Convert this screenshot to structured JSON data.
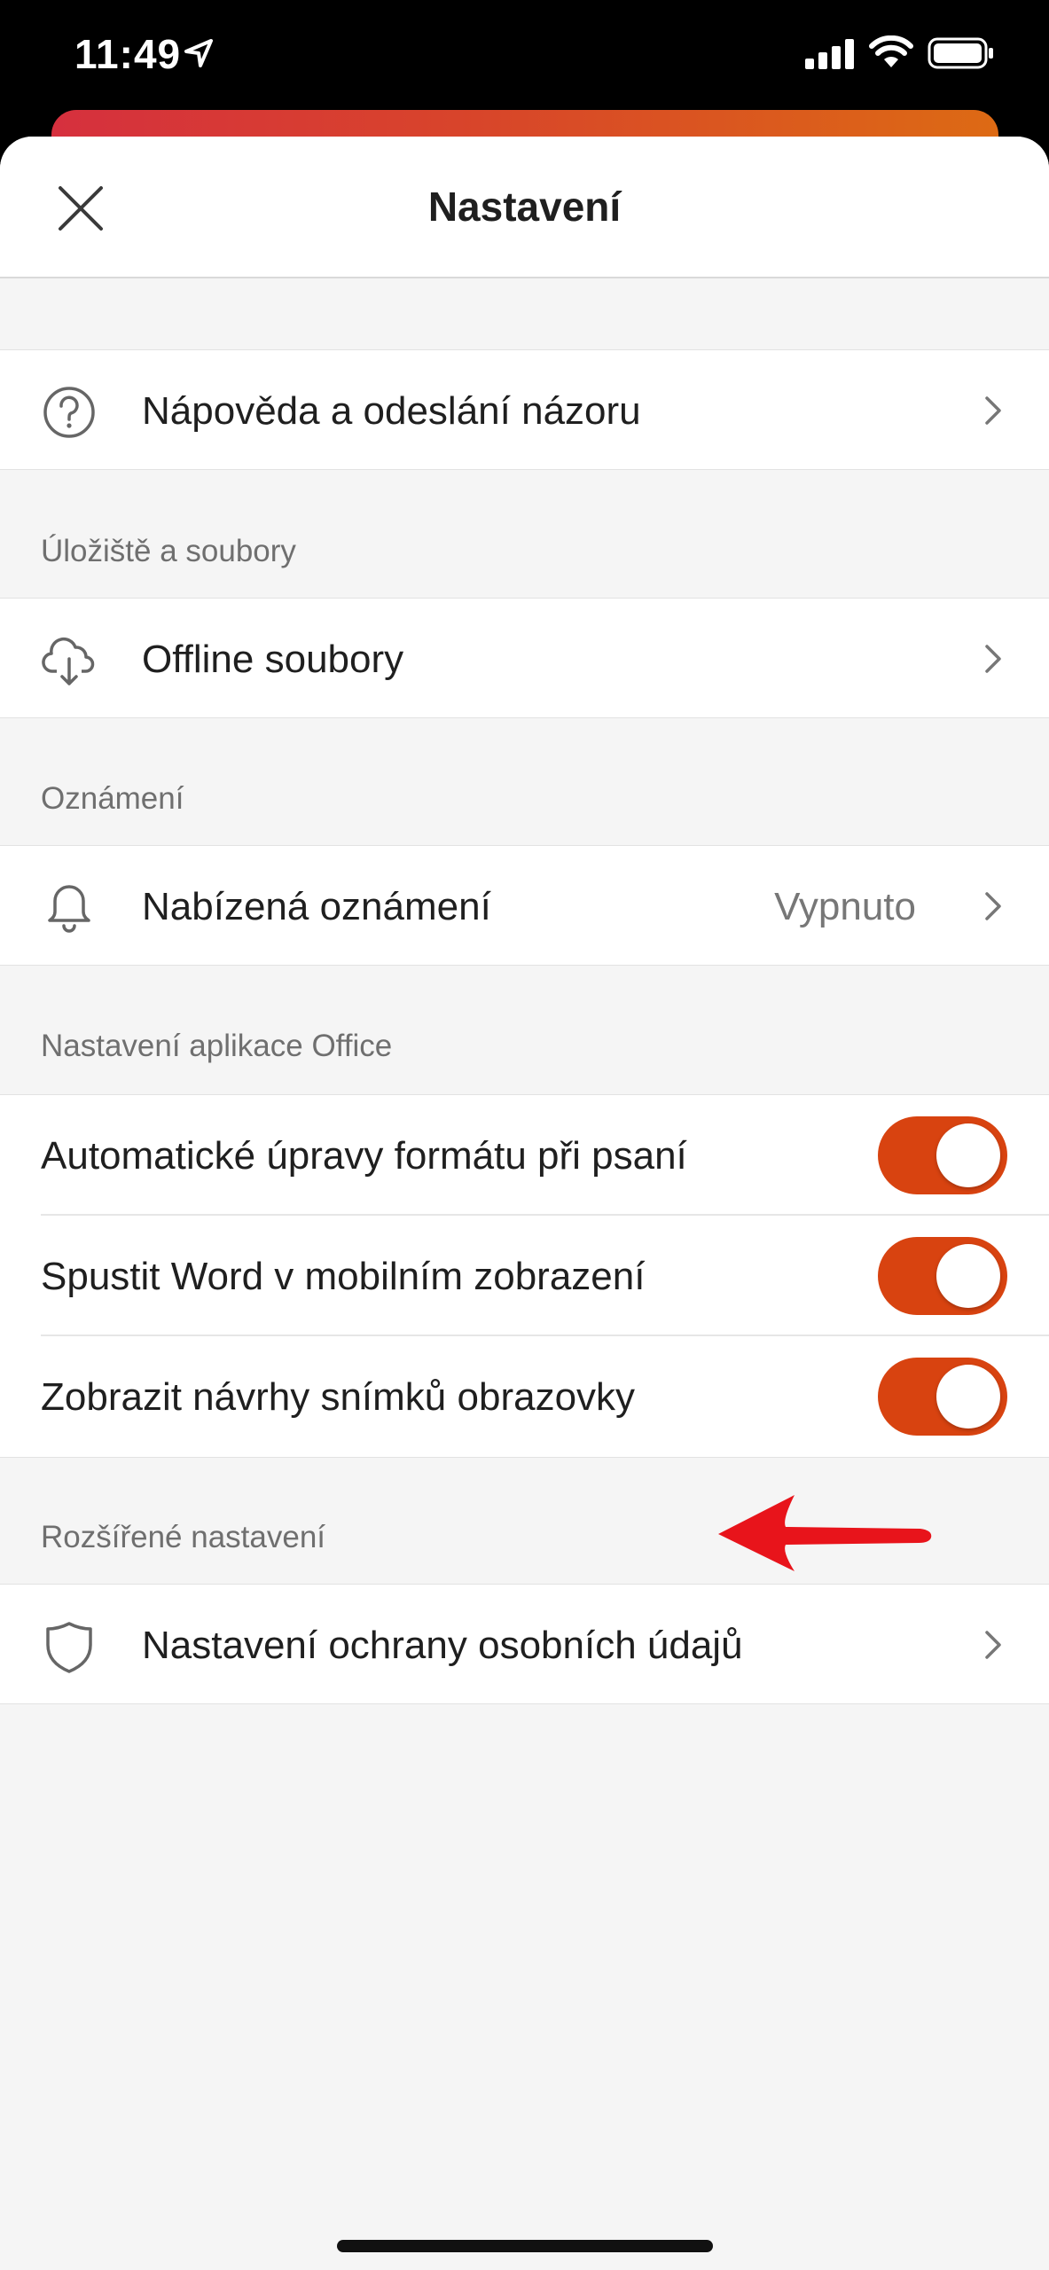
{
  "status_bar": {
    "time": "11:49"
  },
  "header": {
    "title": "Nastavení"
  },
  "help_row": {
    "label": "Nápověda a odeslání názoru"
  },
  "storage": {
    "section_label": "Úložiště a soubory",
    "offline_label": "Offline soubory"
  },
  "notifications": {
    "section_label": "Oznámení",
    "push_label": "Nabízená oznámení",
    "push_value": "Vypnuto"
  },
  "office_settings": {
    "section_label": "Nastavení aplikace Office",
    "toggles": [
      {
        "label": "Automatické úpravy formátu při psaní",
        "on": true
      },
      {
        "label": "Spustit Word v mobilním zobrazení",
        "on": true
      },
      {
        "label": "Zobrazit návrhy snímků obrazovky",
        "on": true
      }
    ]
  },
  "advanced": {
    "section_label": "Rozšířené nastavení",
    "privacy_label": "Nastavení ochrany osobních údajů"
  },
  "colors": {
    "accent": "#d84310",
    "annotation_arrow": "#e8141b"
  },
  "icons": [
    "location-arrow-icon",
    "signal-icon",
    "wifi-icon",
    "battery-icon",
    "close-icon",
    "help-circle-icon",
    "cloud-download-icon",
    "bell-icon",
    "shield-icon",
    "chevron-right-icon"
  ]
}
